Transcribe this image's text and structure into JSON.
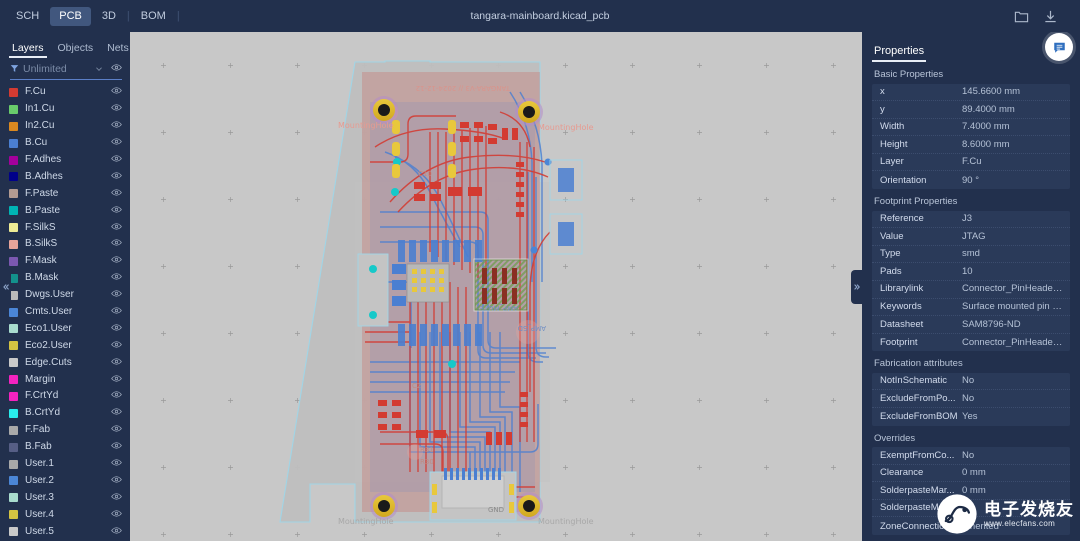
{
  "window": {
    "document_title": "tangara-mainboard.kicad_pcb",
    "doc_tabs": [
      {
        "label": "SCH",
        "active": false
      },
      {
        "label": "PCB",
        "active": true
      },
      {
        "label": "3D",
        "active": false
      },
      {
        "label": "BOM",
        "active": false
      }
    ],
    "toolbar_icons": [
      {
        "name": "folder-icon",
        "label": "Open folder"
      },
      {
        "name": "download-icon",
        "label": "Download"
      }
    ]
  },
  "left_panel": {
    "tabs": [
      {
        "label": "Layers",
        "active": true
      },
      {
        "label": "Objects",
        "active": false
      },
      {
        "label": "Nets",
        "active": false
      }
    ],
    "filter": {
      "placeholder": "Unlimited",
      "value": "",
      "icon": "funnel-icon",
      "chevron": "chevron-down-icon",
      "eye": "eye-icon"
    },
    "layers": [
      {
        "name": "F.Cu",
        "color": "#d33b32"
      },
      {
        "name": "In1.Cu",
        "color": "#69cc6b"
      },
      {
        "name": "In2.Cu",
        "color": "#d98820"
      },
      {
        "name": "B.Cu",
        "color": "#4b7fd1"
      },
      {
        "name": "F.Adhes",
        "color": "#a4009c"
      },
      {
        "name": "B.Adhes",
        "color": "#00008a"
      },
      {
        "name": "F.Paste",
        "color": "#b39b92"
      },
      {
        "name": "B.Paste",
        "color": "#00b4b4"
      },
      {
        "name": "F.SilkS",
        "color": "#eeeb95"
      },
      {
        "name": "B.SilkS",
        "color": "#e8a49a"
      },
      {
        "name": "F.Mask",
        "color": "#7b58b0"
      },
      {
        "name": "B.Mask",
        "color": "#13918c"
      },
      {
        "name": "Dwgs.User",
        "color": "#b9b9b9"
      },
      {
        "name": "Cmts.User",
        "color": "#4b86d6"
      },
      {
        "name": "Eco1.User",
        "color": "#a9dcce"
      },
      {
        "name": "Eco2.User",
        "color": "#d4c342"
      },
      {
        "name": "Edge.Cuts",
        "color": "#c9c9c9"
      },
      {
        "name": "Margin",
        "color": "#f423c0"
      },
      {
        "name": "F.CrtYd",
        "color": "#f423c0"
      },
      {
        "name": "B.CrtYd",
        "color": "#29ecec"
      },
      {
        "name": "F.Fab",
        "color": "#a9a9a9"
      },
      {
        "name": "B.Fab",
        "color": "#565e85"
      },
      {
        "name": "User.1",
        "color": "#a9a9a9"
      },
      {
        "name": "User.2",
        "color": "#4b86d6"
      },
      {
        "name": "User.3",
        "color": "#a9dcce"
      },
      {
        "name": "User.4",
        "color": "#d4c342"
      },
      {
        "name": "User.5",
        "color": "#c9c9c9"
      }
    ]
  },
  "canvas": {
    "left_handle_icon": "chevron-double-left-icon",
    "right_handle_icon": "chevron-double-right-icon",
    "board_labels": [
      "MountingHole",
      "MountingHole",
      "MountingHole",
      "MountingHole",
      "AMP_MUTE",
      "AMP_SD",
      "C10",
      "C2",
      "R31",
      "R30",
      "GND"
    ]
  },
  "right_panel": {
    "title": "Properties",
    "chat_icon": "chat-bubble-icon",
    "sections": [
      {
        "title": "Basic Properties",
        "rows": [
          {
            "key": "x",
            "value": "145.6600 mm"
          },
          {
            "key": "y",
            "value": "89.4000 mm"
          },
          {
            "key": "Width",
            "value": "7.4000 mm"
          },
          {
            "key": "Height",
            "value": "8.6000 mm"
          },
          {
            "key": "Layer",
            "value": "F.Cu"
          },
          {
            "key": "Orientation",
            "value": "90 °"
          }
        ]
      },
      {
        "title": "Footprint Properties",
        "rows": [
          {
            "key": "Reference",
            "value": "J3"
          },
          {
            "key": "Value",
            "value": "JTAG"
          },
          {
            "key": "Type",
            "value": "smd"
          },
          {
            "key": "Pads",
            "value": "10"
          },
          {
            "key": "Librarylink",
            "value": "Connector_PinHeader_1..."
          },
          {
            "key": "Keywords",
            "value": "Surface mounted pin he..."
          },
          {
            "key": "Datasheet",
            "value": "SAM8796-ND"
          },
          {
            "key": "Footprint",
            "value": "Connector_PinHeader_1..."
          }
        ]
      },
      {
        "title": "Fabrication attributes",
        "rows": [
          {
            "key": "NotInSchematic",
            "value": "No"
          },
          {
            "key": "ExcludeFromPo...",
            "value": "No"
          },
          {
            "key": "ExcludeFromBOM",
            "value": "Yes"
          }
        ]
      },
      {
        "title": "Overrides",
        "rows": [
          {
            "key": "ExemptFromCo...",
            "value": "No"
          },
          {
            "key": "Clearance",
            "value": "0 mm"
          },
          {
            "key": "SolderpasteMar...",
            "value": "0 mm"
          },
          {
            "key": "SolderpasteMar...",
            "value": "0"
          },
          {
            "key": "ZoneConnection",
            "value": "Inherited"
          }
        ]
      }
    ]
  },
  "watermark": {
    "cn_text": "电子发烧友",
    "url_text": "www.elecfans.com",
    "logo_icon": "circuit-logo-icon"
  },
  "colors": {
    "panel_bg": "#22304d",
    "canvas_bg": "#c8c8c8",
    "accent": "#4b86d6",
    "table_bg": "#2a3a59",
    "front_copper": "#d33b32",
    "back_copper": "#4b7fd1"
  }
}
